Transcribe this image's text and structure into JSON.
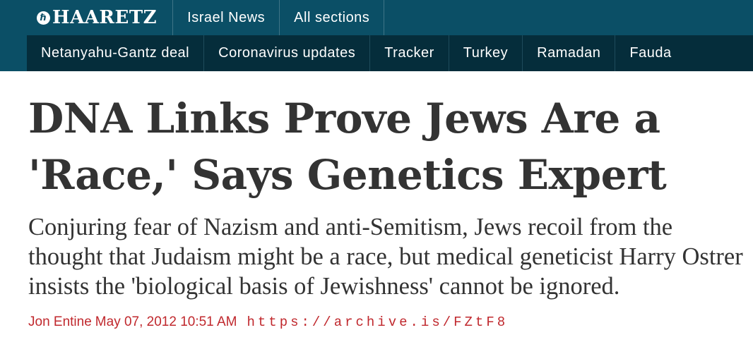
{
  "header": {
    "logo_text": "HAARETZ",
    "logo_mark": "ℏ",
    "top_nav": [
      "Israel News",
      "All sections"
    ],
    "sub_nav": [
      "Netanyahu-Gantz deal",
      "Coronavirus updates",
      "Tracker",
      "Turkey",
      "Ramadan",
      "Fauda"
    ]
  },
  "article": {
    "headline": "DNA Links Prove Jews Are a 'Race,' Says Genetics Expert",
    "subhead": "Conjuring fear of Nazism and anti-Semitism, Jews recoil from the thought that Judaism might be a race, but medical geneticist Harry Ostrer insists the 'biological basis of Jewishness' cannot be ignored.",
    "author": "Jon Entine",
    "date": "May 07, 2012 10:51 AM",
    "source_url": "https://archive.is/FZtF8"
  },
  "colors": {
    "nav_bg": "#0b4f66",
    "subnav_bg": "#052d3b",
    "byline_red": "#c0282d",
    "headline_text": "#333333"
  }
}
